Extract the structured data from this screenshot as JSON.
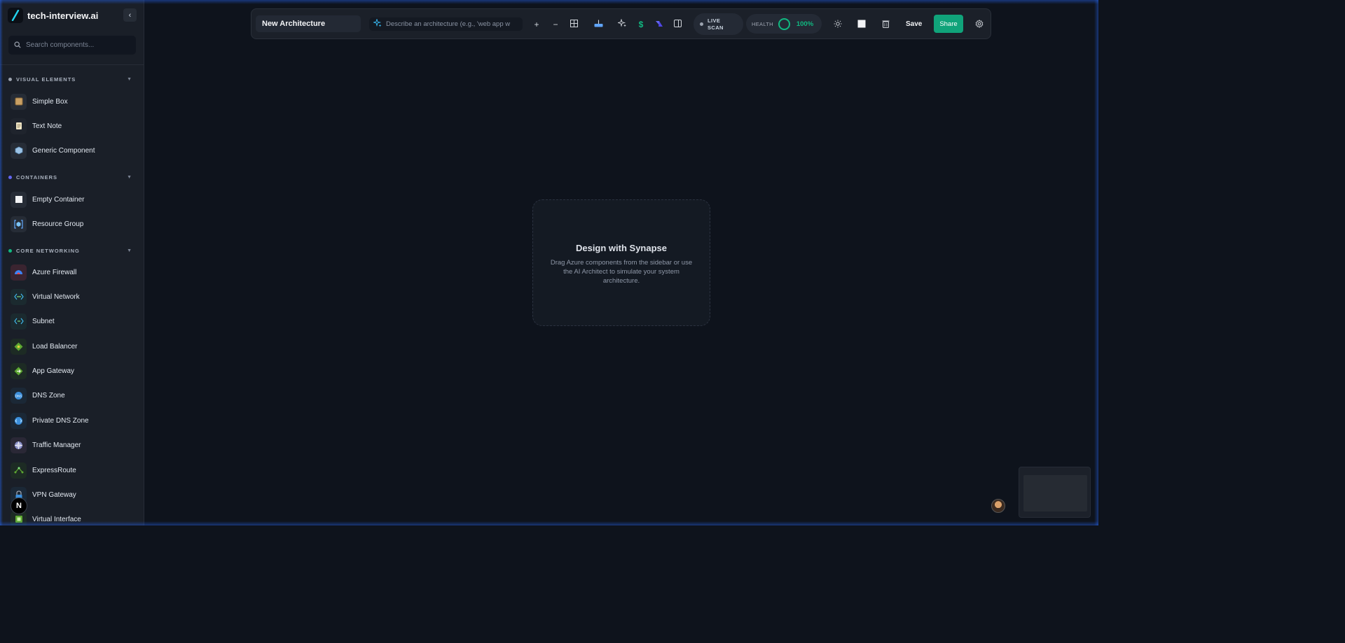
{
  "app": {
    "brand_name": "tech-interview.ai",
    "logo_icon": "slash-logo-icon"
  },
  "sidebar": {
    "collapse_icon": "chevron-left-icon",
    "search_placeholder": "Search components...",
    "sections": [
      {
        "title": "VISUAL ELEMENTS",
        "dot_color": "#9ca3af",
        "items": [
          {
            "label": "Simple Box",
            "icon": "box-icon"
          },
          {
            "label": "Text Note",
            "icon": "note-icon"
          },
          {
            "label": "Generic Component",
            "icon": "cube-icon"
          }
        ]
      },
      {
        "title": "CONTAINERS",
        "dot_color": "#6366f1",
        "items": [
          {
            "label": "Empty Container",
            "icon": "square-icon"
          },
          {
            "label": "Resource Group",
            "icon": "resource-group-icon"
          }
        ]
      },
      {
        "title": "CORE NETWORKING",
        "dot_color": "#10b981",
        "items": [
          {
            "label": "Azure Firewall",
            "icon": "firewall-icon"
          },
          {
            "label": "Virtual Network",
            "icon": "vnet-icon"
          },
          {
            "label": "Subnet",
            "icon": "subnet-icon"
          },
          {
            "label": "Load Balancer",
            "icon": "load-balancer-icon"
          },
          {
            "label": "App Gateway",
            "icon": "app-gateway-icon"
          },
          {
            "label": "DNS Zone",
            "icon": "dns-zone-icon"
          },
          {
            "label": "Private DNS Zone",
            "icon": "private-dns-icon"
          },
          {
            "label": "Traffic Manager",
            "icon": "traffic-manager-icon"
          },
          {
            "label": "ExpressRoute",
            "icon": "expressroute-icon"
          },
          {
            "label": "VPN Gateway",
            "icon": "vpn-gateway-icon"
          },
          {
            "label": "Virtual Interface",
            "icon": "virtual-interface-icon"
          }
        ]
      }
    ]
  },
  "toolbar": {
    "title_value": "New Architecture",
    "ai_placeholder": "Describe an architecture (e.g., 'web app w",
    "zoom_in": "+",
    "zoom_out": "−",
    "live_scan_label": "LIVE SCAN",
    "health_label": "HEALTH",
    "health_value": "100%",
    "save_label": "Save",
    "share_label": "Share"
  },
  "canvas": {
    "empty_title": "Design with Synapse",
    "empty_desc": "Drag Azure components from the sidebar or use the AI Architect to simulate your system architecture."
  },
  "colors": {
    "accent": "#10a37a",
    "health": "#10b981",
    "background": "#0e131c"
  }
}
